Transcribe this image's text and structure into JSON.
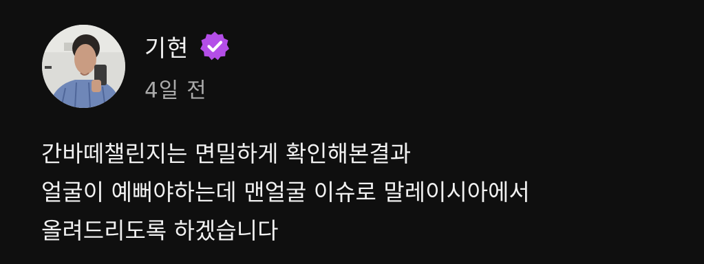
{
  "post": {
    "author": "기현",
    "timestamp": "4일 전",
    "verified": true,
    "badge_color": "#b44ee8",
    "avatar": "profile-photo",
    "text_lines": [
      "간바떼챌린지는 면밀하게 확인해본결과",
      "얼굴이 예뻐야하는데 맨얼굴 이슈로 말레이시아에서",
      "올려드리도록 하겠습니다"
    ]
  }
}
